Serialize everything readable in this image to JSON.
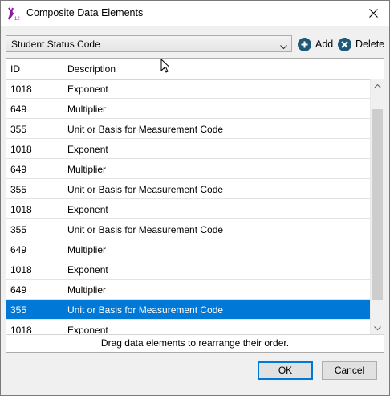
{
  "window": {
    "title": "Composite Data Elements"
  },
  "toolbar": {
    "selected_element": "Student Status Code",
    "add_label": "Add",
    "delete_label": "Delete"
  },
  "grid": {
    "columns": [
      "ID",
      "Description"
    ],
    "rows": [
      {
        "id": "1018",
        "description": "Exponent"
      },
      {
        "id": "649",
        "description": "Multiplier"
      },
      {
        "id": "355",
        "description": "Unit or Basis for Measurement Code"
      },
      {
        "id": "1018",
        "description": "Exponent"
      },
      {
        "id": "649",
        "description": "Multiplier"
      },
      {
        "id": "355",
        "description": "Unit or Basis for Measurement Code"
      },
      {
        "id": "1018",
        "description": "Exponent"
      },
      {
        "id": "355",
        "description": "Unit or Basis for Measurement Code"
      },
      {
        "id": "649",
        "description": "Multiplier"
      },
      {
        "id": "1018",
        "description": "Exponent"
      },
      {
        "id": "649",
        "description": "Multiplier"
      },
      {
        "id": "355",
        "description": "Unit or Basis for Measurement Code"
      },
      {
        "id": "1018",
        "description": "Exponent"
      }
    ],
    "selected_row_index": 11,
    "hint": "Drag data elements to rearrange their order."
  },
  "buttons": {
    "ok": "OK",
    "cancel": "Cancel"
  },
  "colors": {
    "accent": "#0078d7",
    "icon_button": "#1e5a78",
    "app_icon": "#8b1a9b"
  },
  "icons": {
    "app": "x12-logo-icon",
    "close": "close-icon",
    "dropdown": "chevron-down-icon",
    "add": "plus-circle-icon",
    "delete": "x-circle-icon"
  }
}
